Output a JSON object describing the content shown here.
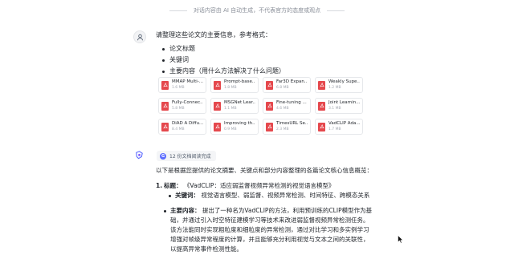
{
  "disclaimer": "对话内容由 AI 自动生成，不代表官方的态度或观点",
  "user_message": {
    "prompt": "请整理这些论文的主要信息，参考格式：",
    "bullets": [
      "论文标题",
      "关键词",
      "主要内容（用什么方法解决了什么问题）"
    ]
  },
  "files": [
    {
      "name": "MMAP Multi-...",
      "size": "1.6 MB"
    },
    {
      "name": "Prompt-base...",
      "size": "1.8 MB"
    },
    {
      "name": "Far3D Expan...",
      "size": "6.8 MB"
    },
    {
      "name": "Weakly Supe...",
      "size": "1.2 MB"
    },
    {
      "name": "Fully-Connec...",
      "size": "5.8 MB"
    },
    {
      "name": "MSGNet Lear...",
      "size": "1.1 MB"
    },
    {
      "name": "Fine-tuning ...",
      "size": "4.6 MB"
    },
    {
      "name": "Joint Learnin...",
      "size": "3.1 MB"
    },
    {
      "name": "DiAD A Diffu...",
      "size": "8.4 MB"
    },
    {
      "name": "Improving th...",
      "size": "0.9 MB"
    },
    {
      "name": "TimesURL Se...",
      "size": "2.3 MB"
    },
    {
      "name": "VadCLIP Ada...",
      "size": "1.7 MB"
    }
  ],
  "doc_status": "12 份文档阅读完成",
  "answer": {
    "intro": "以下是根据您提供的论文摘要、关键点和部分内容整理的各篇论文核心信息概览：",
    "item_number": "1.",
    "title_label": "标题：",
    "title_value": "《VadCLIP：适应弱监督视频异常检测的视觉语言模型》",
    "keywords_label": "关键词：",
    "keywords_value": "视觉语言模型、弱监督、视频异常检测、时间特征、跨模态关系",
    "content_label": "主要内容：",
    "content_value": "提出了一种名为VadCLIP的方法，利用预训练的CLIP模型作为基础，并通过引入时空特征建模学习等技术来改进弱监督视频异常检测任务。该方法能同时实现粗粒度和细粒度的异常检测，通过对比学习和多实例学习增强对帧级异常程度的计算，并且能够充分利用视觉与文本之间的关联性，以提高异常事件检测性能。"
  },
  "colors": {
    "pdf_icon": "#e5484d",
    "accent": "#5b6cff",
    "text": "#1f2329",
    "muted": "#8a8f99"
  }
}
